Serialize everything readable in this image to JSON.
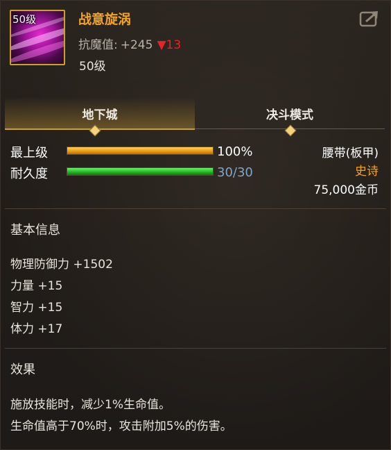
{
  "item": {
    "level_badge": "50级",
    "name": "战意旋涡",
    "resist_label": "抗魔值:",
    "resist_value": "+245",
    "resist_change": "▼13",
    "required_level": "50级",
    "slot": "腰带(板甲)",
    "rarity": "史诗",
    "price": "75,000金币"
  },
  "tabs": [
    {
      "label": "地下城",
      "active": true
    },
    {
      "label": "决斗模式",
      "active": false
    }
  ],
  "stats": {
    "grade_label": "最上级",
    "grade_text": "100%",
    "grade_fraction": 1.0,
    "durability_label": "耐久度",
    "durability_text": "30/30",
    "durability_fraction": 1.0
  },
  "basic_info": {
    "title": "基本信息",
    "lines": [
      "物理防御力 +1502",
      "力量 +15",
      "智力 +15",
      "体力 +17"
    ]
  },
  "effect": {
    "title": "效果",
    "lines": [
      "施放技能时，减少1%生命值。",
      "生命值高于70%时，攻击附加5%的伤害。"
    ]
  },
  "colors": {
    "accent_gold": "#f3a324",
    "rarity": "#f3a324",
    "decrease": "#e8222a",
    "durability_text": "#7fa6c8"
  },
  "icons": {
    "share": "share-export-icon",
    "tab_marker": "diamond-icon"
  }
}
